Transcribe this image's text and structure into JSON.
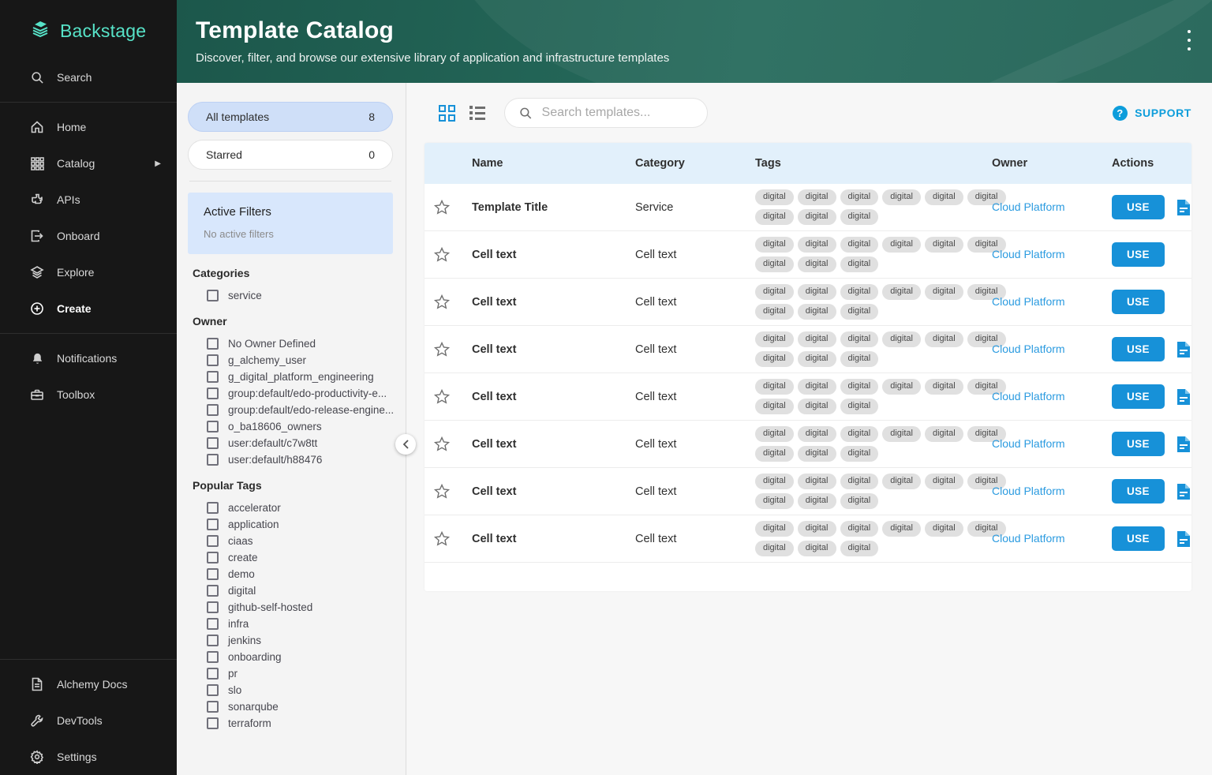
{
  "sidebar": {
    "brand": "Backstage",
    "search": {
      "label": "Search"
    },
    "main": [
      {
        "label": "Home"
      },
      {
        "label": "Catalog"
      },
      {
        "label": "APIs"
      },
      {
        "label": "Onboard"
      },
      {
        "label": "Explore"
      },
      {
        "label": "Create"
      }
    ],
    "secondary": [
      {
        "label": "Notifications"
      },
      {
        "label": "Toolbox"
      }
    ],
    "bottom": [
      {
        "label": "Alchemy Docs"
      },
      {
        "label": "DevTools"
      },
      {
        "label": "Settings"
      }
    ]
  },
  "header": {
    "title": "Template Catalog",
    "subtitle": "Discover, filter, and browse our extensive library of application and infrastructure templates"
  },
  "filters": {
    "all_templates_label": "All templates",
    "all_templates_count": "8",
    "starred_label": "Starred",
    "starred_count": "0",
    "active_filters_title": "Active Filters",
    "active_filters_empty": "No active filters",
    "categories_title": "Categories",
    "categories": [
      "service"
    ],
    "owner_title": "Owner",
    "owners": [
      "No Owner Defined",
      "g_alchemy_user",
      "g_digital_platform_engineering",
      "group:default/edo-productivity-e...",
      "group:default/edo-release-engine...",
      "o_ba18606_owners",
      "user:default/c7w8tt",
      "user:default/h88476"
    ],
    "popular_tags_title": "Popular Tags",
    "popular_tags": [
      "accelerator",
      "application",
      "ciaas",
      "create",
      "demo",
      "digital",
      "github-self-hosted",
      "infra",
      "jenkins",
      "onboarding",
      "pr",
      "slo",
      "sonarqube",
      "terraform"
    ]
  },
  "toolbar": {
    "search_placeholder": "Search templates...",
    "support_label": "SUPPORT"
  },
  "table": {
    "columns": {
      "name": "Name",
      "category": "Category",
      "tags": "Tags",
      "owner": "Owner",
      "actions": "Actions"
    },
    "use_label": "USE",
    "rows": [
      {
        "name": "Template Title",
        "category": "Service",
        "tags": [
          "digital",
          "digital",
          "digital",
          "digital",
          "digital",
          "digital",
          "digital",
          "digital",
          "digital"
        ],
        "owner": "Cloud Platform",
        "has_doc": true
      },
      {
        "name": "Cell text",
        "category": "Cell text",
        "tags": [
          "digital",
          "digital",
          "digital",
          "digital",
          "digital",
          "digital",
          "digital",
          "digital",
          "digital"
        ],
        "owner": "Cloud Platform",
        "has_doc": false
      },
      {
        "name": "Cell text",
        "category": "Cell text",
        "tags": [
          "digital",
          "digital",
          "digital",
          "digital",
          "digital",
          "digital",
          "digital",
          "digital",
          "digital"
        ],
        "owner": "Cloud Platform",
        "has_doc": false
      },
      {
        "name": "Cell text",
        "category": "Cell text",
        "tags": [
          "digital",
          "digital",
          "digital",
          "digital",
          "digital",
          "digital",
          "digital",
          "digital",
          "digital"
        ],
        "owner": "Cloud Platform",
        "has_doc": true
      },
      {
        "name": "Cell text",
        "category": "Cell text",
        "tags": [
          "digital",
          "digital",
          "digital",
          "digital",
          "digital",
          "digital",
          "digital",
          "digital",
          "digital"
        ],
        "owner": "Cloud Platform",
        "has_doc": true
      },
      {
        "name": "Cell text",
        "category": "Cell text",
        "tags": [
          "digital",
          "digital",
          "digital",
          "digital",
          "digital",
          "digital",
          "digital",
          "digital",
          "digital"
        ],
        "owner": "Cloud Platform",
        "has_doc": true
      },
      {
        "name": "Cell text",
        "category": "Cell text",
        "tags": [
          "digital",
          "digital",
          "digital",
          "digital",
          "digital",
          "digital",
          "digital",
          "digital",
          "digital"
        ],
        "owner": "Cloud Platform",
        "has_doc": true
      },
      {
        "name": "Cell text",
        "category": "Cell text",
        "tags": [
          "digital",
          "digital",
          "digital",
          "digital",
          "digital",
          "digital",
          "digital",
          "digital",
          "digital"
        ],
        "owner": "Cloud Platform",
        "has_doc": true
      }
    ]
  },
  "colors": {
    "brand_teal": "#57e3c8",
    "header_green": "#25695a",
    "accent_blue": "#1791d8",
    "support_blue": "#0d9ddb",
    "link_blue": "#2b9be0",
    "table_head_bg": "#e2f0fb",
    "active_pill_bg": "#cfdff8",
    "active_filters_bg": "#d8e7fc",
    "tag_chip_bg": "#e0e0e0",
    "sidebar_bg": "#171717"
  }
}
